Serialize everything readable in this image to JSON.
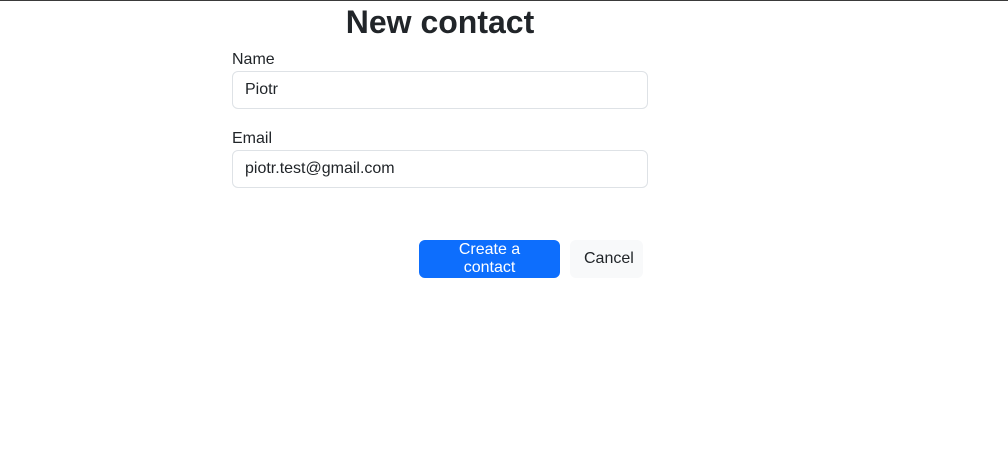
{
  "page": {
    "title": "New contact"
  },
  "form": {
    "name": {
      "label": "Name",
      "value": "Piotr"
    },
    "email": {
      "label": "Email",
      "value": "piotr.test@gmail.com"
    }
  },
  "actions": {
    "create_label": "Create a contact",
    "cancel_label": "Cancel"
  },
  "colors": {
    "primary": "#0d6efd",
    "light": "#f8f9fa",
    "text": "#212529",
    "input_border": "#dee2e6"
  }
}
